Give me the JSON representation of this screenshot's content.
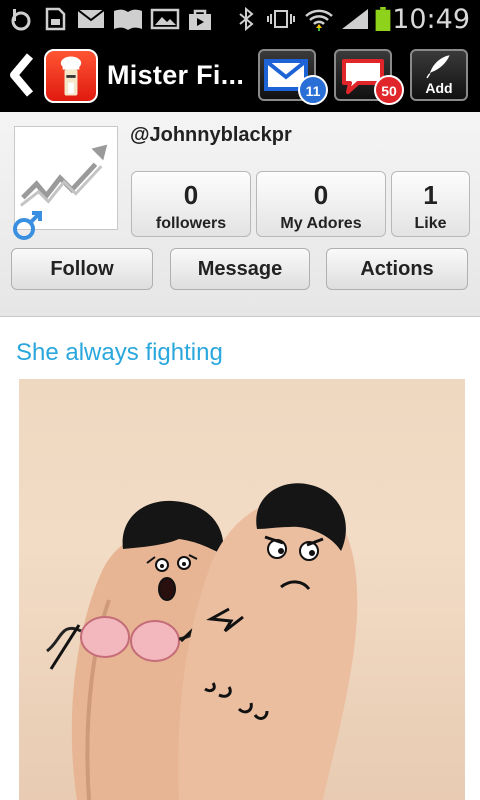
{
  "status_bar": {
    "time": "10:49"
  },
  "action_bar": {
    "title": "Mister Fi...",
    "messages_badge": "11",
    "comments_badge": "50",
    "add_label": "Add",
    "accent_blue": "#2a6fd6",
    "accent_red": "#e0262a"
  },
  "profile": {
    "username": "@Johnnyblackpr",
    "stats": [
      {
        "value": "0",
        "label": "followers"
      },
      {
        "value": "0",
        "label": "My Adores"
      },
      {
        "value": "1",
        "label": "Like"
      }
    ],
    "buttons": {
      "follow": "Follow",
      "message": "Message",
      "actions": "Actions"
    }
  },
  "post": {
    "title": "She always fighting",
    "title_color": "#2aa7dc"
  }
}
